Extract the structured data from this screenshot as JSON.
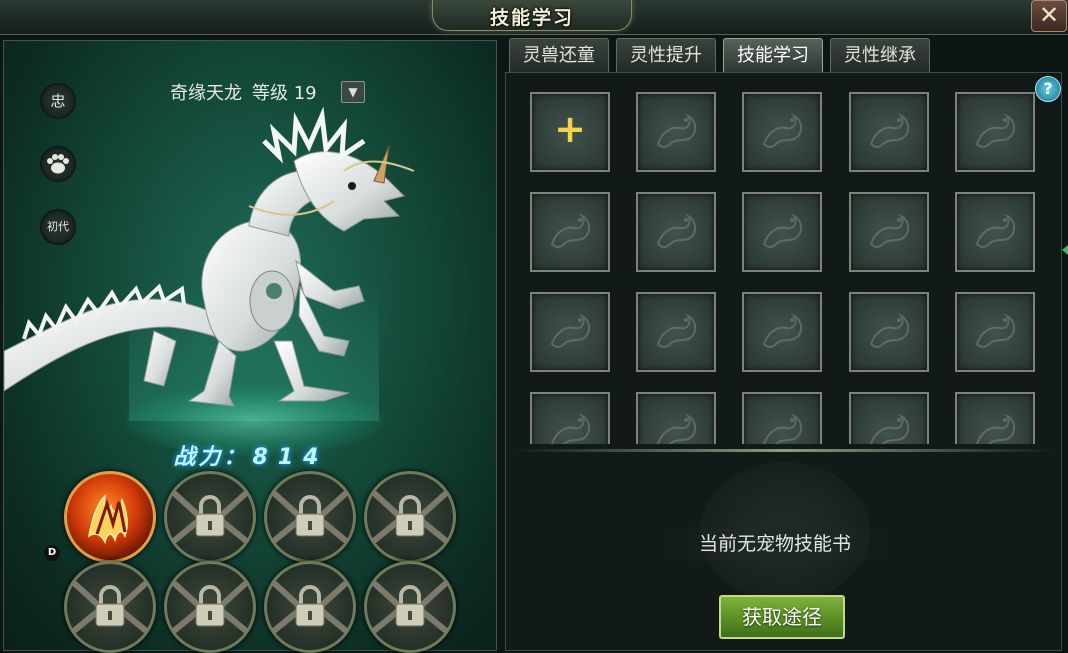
{
  "window": {
    "title": "技能学习",
    "close_icon": "✕"
  },
  "pet": {
    "name": "奇缘天龙",
    "level_label": "等级 19",
    "side_icons": [
      {
        "name": "loyalty-icon",
        "label": "忠"
      },
      {
        "name": "paw-icon",
        "label": ""
      },
      {
        "name": "generation-icon",
        "label": "初代"
      }
    ],
    "power_label": "战力：",
    "power_value": "814",
    "skill_slots": [
      {
        "state": "active",
        "icon": "fire-skill-icon"
      },
      {
        "state": "locked",
        "icon": "lock-icon"
      },
      {
        "state": "locked",
        "icon": "lock-icon"
      },
      {
        "state": "locked",
        "icon": "lock-icon"
      },
      {
        "state": "locked",
        "icon": "lock-icon"
      },
      {
        "state": "locked",
        "icon": "lock-icon"
      },
      {
        "state": "locked",
        "icon": "lock-icon"
      },
      {
        "state": "locked",
        "icon": "lock-icon"
      }
    ],
    "badge": "D"
  },
  "tabs": [
    {
      "label": "灵兽还童",
      "active": false
    },
    {
      "label": "灵性提升",
      "active": false
    },
    {
      "label": "技能学习",
      "active": true
    },
    {
      "label": "灵性继承",
      "active": false
    }
  ],
  "help_label": "?",
  "skill_grid": {
    "first_cell_symbol": "+"
  },
  "empty_message": "当前无宠物技能书",
  "get_button_label": "获取途径",
  "colors": {
    "accent_gold": "#f3d34a",
    "button_green": "#5f9428",
    "power_glow": "#2fb5ff"
  }
}
